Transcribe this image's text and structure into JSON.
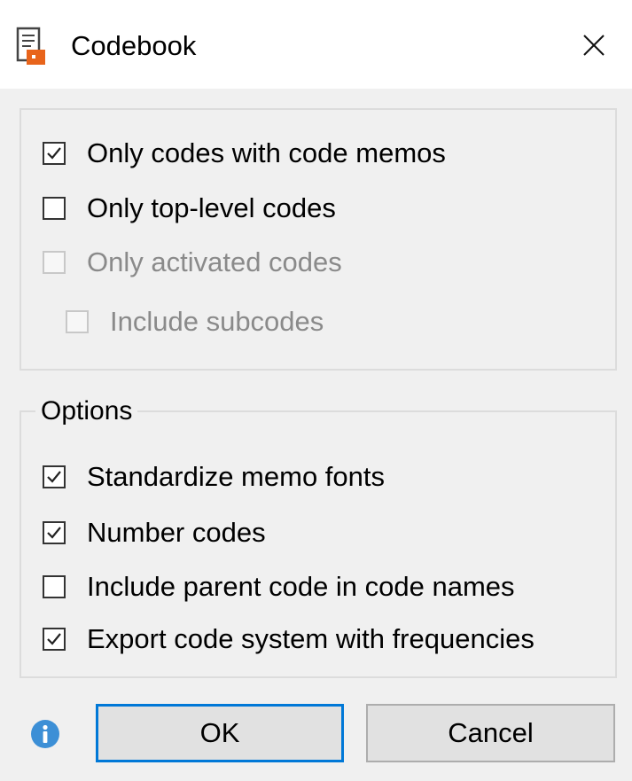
{
  "window": {
    "title": "Codebook",
    "title_icon": "codebook-doc-icon",
    "close_icon": "close-icon"
  },
  "filters": {
    "items": [
      {
        "label": "Only codes with code memos",
        "checked": true,
        "enabled": true
      },
      {
        "label": "Only top-level codes",
        "checked": false,
        "enabled": true
      },
      {
        "label": "Only activated codes",
        "checked": false,
        "enabled": false
      },
      {
        "label": "Include subcodes",
        "checked": false,
        "enabled": false
      }
    ]
  },
  "options": {
    "legend": "Options",
    "items": [
      {
        "label": "Standardize memo fonts",
        "checked": true
      },
      {
        "label": "Number codes",
        "checked": true
      },
      {
        "label": "Include parent code in code names",
        "checked": false
      },
      {
        "label": "Export code system with frequencies",
        "checked": true
      }
    ]
  },
  "footer": {
    "info_icon": "info-icon",
    "ok_label": "OK",
    "cancel_label": "Cancel"
  },
  "colors": {
    "accent": "#0078d7",
    "title_icon_orange": "#e8641b",
    "info_blue": "#3c8fd6"
  }
}
